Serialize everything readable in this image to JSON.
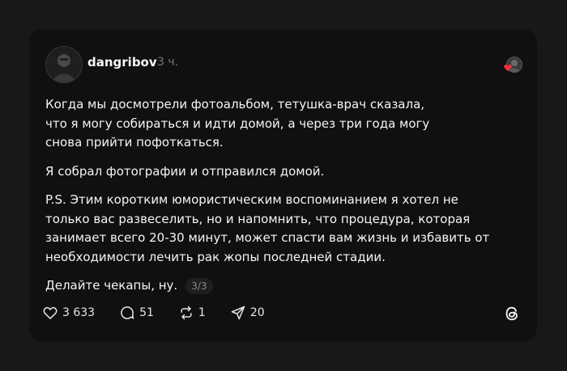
{
  "post": {
    "author": "dangribov",
    "time": "3 ч.",
    "paragraphs": [
      "Когда мы досмотрели фотоальбом, тетушка-врач сказала, что я могу собираться и идти домой, а через три года могу снова прийти пофоткаться.",
      "Я собрал фотографии и отправился домой.",
      "P.S. Этим коротким юмористическим воспоминанием я хотел не только вас развеселить, но и напомнить, что процедура, которая занимает всего 20-30 минут, может спасти вам жизнь и избавить от необходимости лечить рак жопы последней стадии."
    ],
    "closing": "Делайте чекапы, ну.",
    "page_counter": "3/3"
  },
  "actions": {
    "likes": "3 633",
    "comments": "51",
    "reposts": "1",
    "shares": "20"
  },
  "colors": {
    "background": "#181818",
    "card": "#101010",
    "text": "#f3f5f7",
    "muted": "#777777",
    "heart": "#ff3040"
  },
  "icons": [
    "heart-icon",
    "comment-icon",
    "repost-icon",
    "share-icon",
    "threads-logo-icon"
  ]
}
